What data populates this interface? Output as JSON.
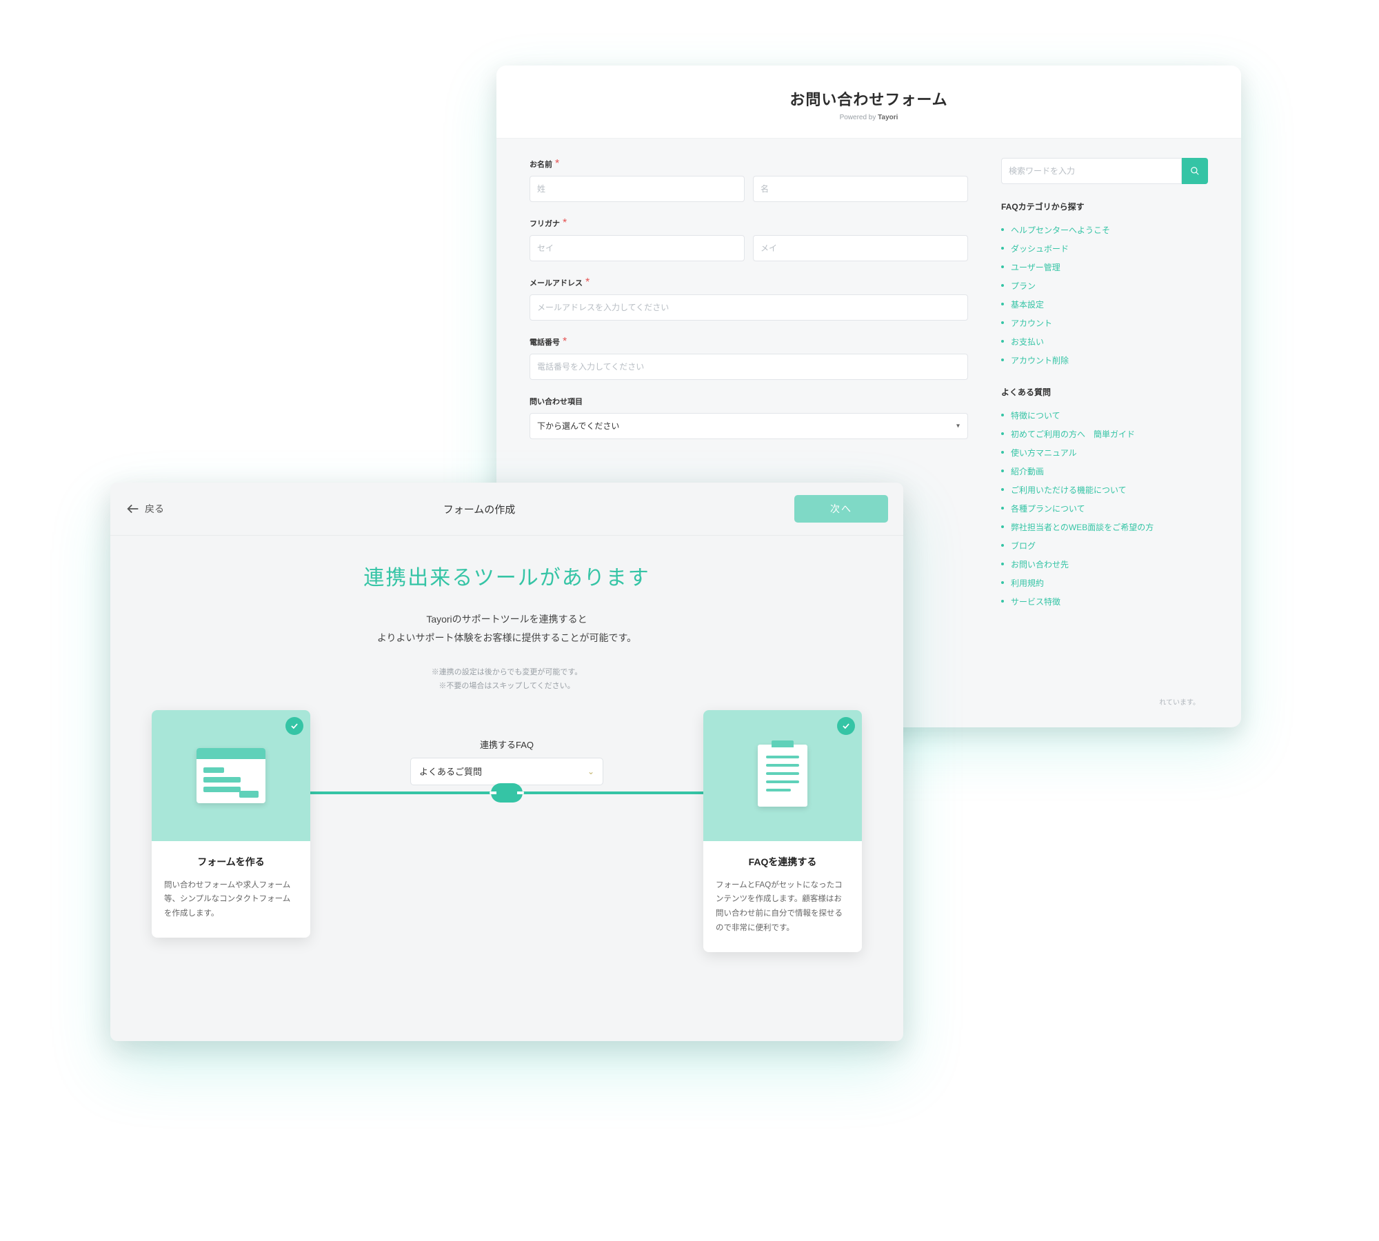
{
  "backWindow": {
    "title": "お問い合わせフォーム",
    "poweredPrefix": "Powered by ",
    "poweredBrand": "Tayori",
    "fields": {
      "name": {
        "label": "お名前",
        "ph1": "姓",
        "ph2": "名"
      },
      "kana": {
        "label": "フリガナ",
        "ph1": "セイ",
        "ph2": "メイ"
      },
      "email": {
        "label": "メールアドレス",
        "ph": "メールアドレスを入力してください"
      },
      "phone": {
        "label": "電話番号",
        "ph": "電話番号を入力してください"
      },
      "topic": {
        "label": "問い合わせ項目",
        "ph": "下から選んでください"
      }
    },
    "searchPh": "検索ワードを入力",
    "cat": {
      "heading": "FAQカテゴリから探す",
      "items": [
        "ヘルプセンターへようこそ",
        "ダッシュボード",
        "ユーザー管理",
        "プラン",
        "基本設定",
        "アカウント",
        "お支払い",
        "アカウント削除"
      ]
    },
    "faq": {
      "heading": "よくある質問",
      "items": [
        "特徴について",
        "初めてご利用の方へ　簡単ガイド",
        "使い方マニュアル",
        "紹介動画",
        "ご利用いただける機能について",
        "各種プランについて",
        "弊社担当者とのWEB面談をご希望の方",
        "ブログ",
        "お問い合わせ先",
        "利用規約",
        "サービス特徴"
      ]
    },
    "footerNote": "れています。"
  },
  "frontWindow": {
    "back": "戻る",
    "topTitle": "フォームの作成",
    "next": "次へ",
    "hero": "連携出来るツールがあります",
    "desc1": "Tayoriのサポートツールを連携すると",
    "desc2": "よりよいサポート体験をお客様に提供することが可能です。",
    "note1": "※連携の設定は後からでも変更が可能です。",
    "note2": "※不要の場合はスキップしてください。",
    "centerLabel": "連携するFAQ",
    "faqSelected": "よくあるご質問",
    "cardForm": {
      "title": "フォームを作る",
      "desc": "問い合わせフォームや求人フォーム等、シンプルなコンタクトフォームを作成します。"
    },
    "cardFaq": {
      "title": "FAQを連携する",
      "desc": "フォームとFAQがセットになったコンテンツを作成します。顧客様はお問い合わせ前に自分で情報を探せるので非常に便利です。"
    }
  }
}
